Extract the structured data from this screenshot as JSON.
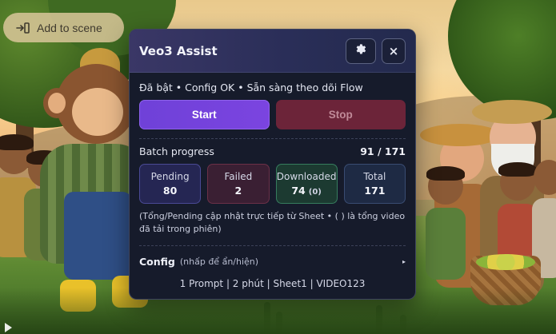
{
  "scene": {
    "add_button_label": "Add to scene",
    "add_icon": "insert-icon"
  },
  "panel": {
    "title": "Veo3 Assist",
    "settings_icon": "gear-icon",
    "close_label": "×",
    "status": "Đã bật • Config OK • Sẵn sàng theo dõi Flow",
    "start_label": "Start",
    "stop_label": "Stop",
    "progress_label": "Batch progress",
    "progress_count": "91 / 171",
    "stats": {
      "pending": {
        "label": "Pending",
        "value": "80"
      },
      "failed": {
        "label": "Failed",
        "value": "2"
      },
      "downloaded": {
        "label": "Downloaded",
        "value": "74",
        "session": "(0)"
      },
      "total": {
        "label": "Total",
        "value": "171"
      }
    },
    "note": "(Tổng/Pending cập nhật trực tiếp từ Sheet • ( ) là tổng video đã tải trong phiên)",
    "config_title": "Config",
    "config_hint": "(nhấp để ẩn/hiện)",
    "config_caret": "▸",
    "config_summary": "1 Prompt | 2 phút | Sheet1 | VIDEO123"
  },
  "colors": {
    "start_button": "#7b44e0",
    "stop_button": "#6c2439",
    "panel_bg": "#161b2b",
    "downloaded_accent": "#1c3a31",
    "failed_accent": "#3a1f33"
  }
}
